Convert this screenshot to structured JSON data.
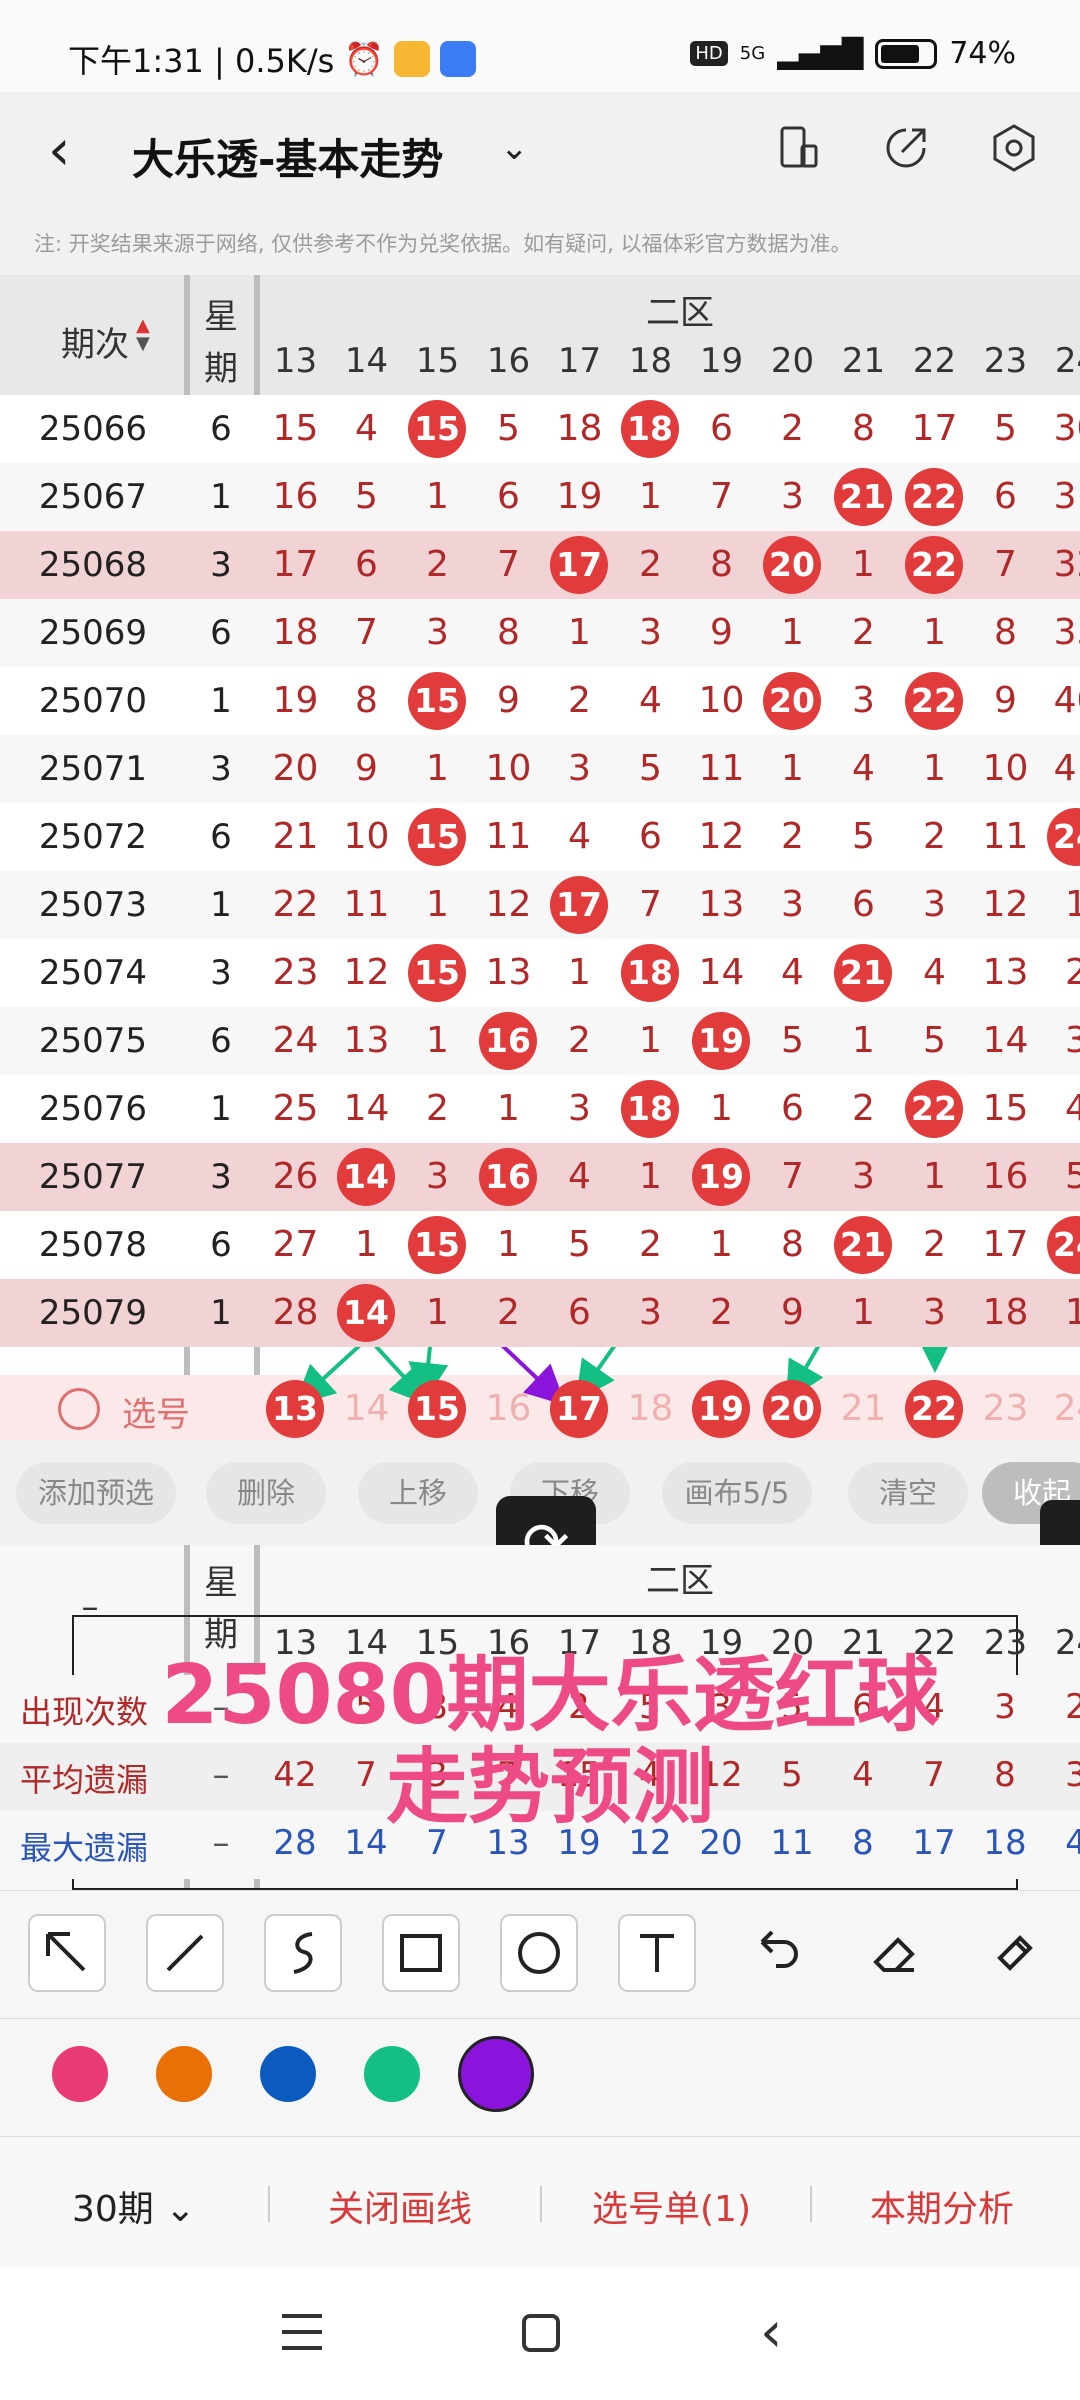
{
  "status": {
    "time_speed": "下午1:31 | 0.5K/s",
    "network": "5G",
    "hd": "HD",
    "battery": "74%"
  },
  "header": {
    "title": "大乐透-基本走势"
  },
  "notice": "注: 开奖结果来源于网络, 仅供参考不作为兑奖依据。如有疑问, 以福体彩官方数据为准。",
  "table": {
    "period_header": "期次",
    "week_header_1": "星",
    "week_header_2": "期",
    "zone_header": "二区",
    "columns": [
      "13",
      "14",
      "15",
      "16",
      "17",
      "18",
      "19",
      "20",
      "21",
      "22",
      "23",
      "24"
    ],
    "rows": [
      {
        "period": "25066",
        "week": "6",
        "values": [
          "15",
          "4",
          "15",
          "5",
          "18",
          "18",
          "6",
          "2",
          "8",
          "17",
          "5",
          "30"
        ],
        "hits": [
          2,
          5
        ],
        "shaded": false
      },
      {
        "period": "25067",
        "week": "1",
        "values": [
          "16",
          "5",
          "1",
          "6",
          "19",
          "1",
          "7",
          "3",
          "21",
          "22",
          "6",
          "31"
        ],
        "hits": [
          8,
          9
        ],
        "shaded": false
      },
      {
        "period": "25068",
        "week": "3",
        "values": [
          "17",
          "6",
          "2",
          "7",
          "17",
          "2",
          "8",
          "20",
          "1",
          "22",
          "7",
          "32"
        ],
        "hits": [
          4,
          7,
          9
        ],
        "shaded": true
      },
      {
        "period": "25069",
        "week": "6",
        "values": [
          "18",
          "7",
          "3",
          "8",
          "1",
          "3",
          "9",
          "1",
          "2",
          "1",
          "8",
          "33"
        ],
        "hits": [],
        "shaded": false
      },
      {
        "period": "25070",
        "week": "1",
        "values": [
          "19",
          "8",
          "15",
          "9",
          "2",
          "4",
          "10",
          "20",
          "3",
          "22",
          "9",
          "40"
        ],
        "hits": [
          2,
          7,
          9
        ],
        "shaded": false
      },
      {
        "period": "25071",
        "week": "3",
        "values": [
          "20",
          "9",
          "1",
          "10",
          "3",
          "5",
          "11",
          "1",
          "4",
          "1",
          "10",
          "41"
        ],
        "hits": [],
        "shaded": false
      },
      {
        "period": "25072",
        "week": "6",
        "values": [
          "21",
          "10",
          "15",
          "11",
          "4",
          "6",
          "12",
          "2",
          "5",
          "2",
          "11",
          "24"
        ],
        "hits": [
          2,
          11
        ],
        "shaded": false
      },
      {
        "period": "25073",
        "week": "1",
        "values": [
          "22",
          "11",
          "1",
          "12",
          "17",
          "7",
          "13",
          "3",
          "6",
          "3",
          "12",
          "1"
        ],
        "hits": [
          4
        ],
        "shaded": false
      },
      {
        "period": "25074",
        "week": "3",
        "values": [
          "23",
          "12",
          "15",
          "13",
          "1",
          "18",
          "14",
          "4",
          "21",
          "4",
          "13",
          "2"
        ],
        "hits": [
          2,
          5,
          8
        ],
        "shaded": false
      },
      {
        "period": "25075",
        "week": "6",
        "values": [
          "24",
          "13",
          "1",
          "16",
          "2",
          "1",
          "19",
          "5",
          "1",
          "5",
          "14",
          "3"
        ],
        "hits": [
          3,
          6
        ],
        "shaded": false
      },
      {
        "period": "25076",
        "week": "1",
        "values": [
          "25",
          "14",
          "2",
          "1",
          "3",
          "18",
          "1",
          "6",
          "2",
          "22",
          "15",
          "4"
        ],
        "hits": [
          5,
          9
        ],
        "shaded": false
      },
      {
        "period": "25077",
        "week": "3",
        "values": [
          "26",
          "14",
          "3",
          "16",
          "4",
          "1",
          "19",
          "7",
          "3",
          "1",
          "16",
          "5"
        ],
        "hits": [
          1,
          3,
          6
        ],
        "shaded": true
      },
      {
        "period": "25078",
        "week": "6",
        "values": [
          "27",
          "1",
          "15",
          "1",
          "5",
          "2",
          "1",
          "8",
          "21",
          "2",
          "17",
          "24"
        ],
        "hits": [
          2,
          8,
          11
        ],
        "shaded": false
      },
      {
        "period": "25079",
        "week": "1",
        "values": [
          "28",
          "14",
          "1",
          "2",
          "6",
          "3",
          "2",
          "9",
          "1",
          "3",
          "18",
          "1"
        ],
        "hits": [
          1
        ],
        "shaded": true
      }
    ],
    "select_label": "选号",
    "select_values": [
      "13",
      "14",
      "15",
      "16",
      "17",
      "18",
      "19",
      "20",
      "21",
      "22",
      "23",
      "24"
    ],
    "select_hits": [
      0,
      2,
      4,
      6,
      7,
      9
    ]
  },
  "toolbar": [
    "添加预选",
    "删除",
    "上移",
    "下移",
    "画布5/5",
    "清空",
    "收起"
  ],
  "stats": {
    "zone_header": "二区",
    "dash": "–",
    "week_header_1": "星",
    "week_header_2": "期",
    "columns": [
      "13",
      "14",
      "15",
      "16",
      "17",
      "18",
      "19",
      "20",
      "21",
      "22",
      "23",
      "24"
    ],
    "rows": [
      {
        "label": "出现次数",
        "values": [
          "",
          "5",
          "8",
          "4",
          "2",
          "5",
          "3",
          "5",
          "6",
          "4",
          "3",
          "2"
        ]
      },
      {
        "label": "平均遗漏",
        "values": [
          "42",
          "7",
          "3",
          "7",
          "15",
          "4",
          "12",
          "5",
          "4",
          "7",
          "8",
          "3"
        ]
      },
      {
        "label": "最大遗漏",
        "values": [
          "28",
          "14",
          "7",
          "13",
          "19",
          "12",
          "20",
          "11",
          "8",
          "17",
          "18",
          "4"
        ]
      }
    ]
  },
  "overlay": {
    "line1": "25080期大乐透红球",
    "line2": "走势预测"
  },
  "colors": {
    "pink": "#e83a73",
    "orange": "#e87007",
    "blue": "#0b5bbf",
    "green": "#13bf83",
    "purple": "#8a14db",
    "ball": "#e23b3b"
  },
  "bottom": {
    "periods": "30期",
    "close_lines": "关闭画线",
    "pick_list": "选号单(1)",
    "analysis": "本期分析"
  }
}
